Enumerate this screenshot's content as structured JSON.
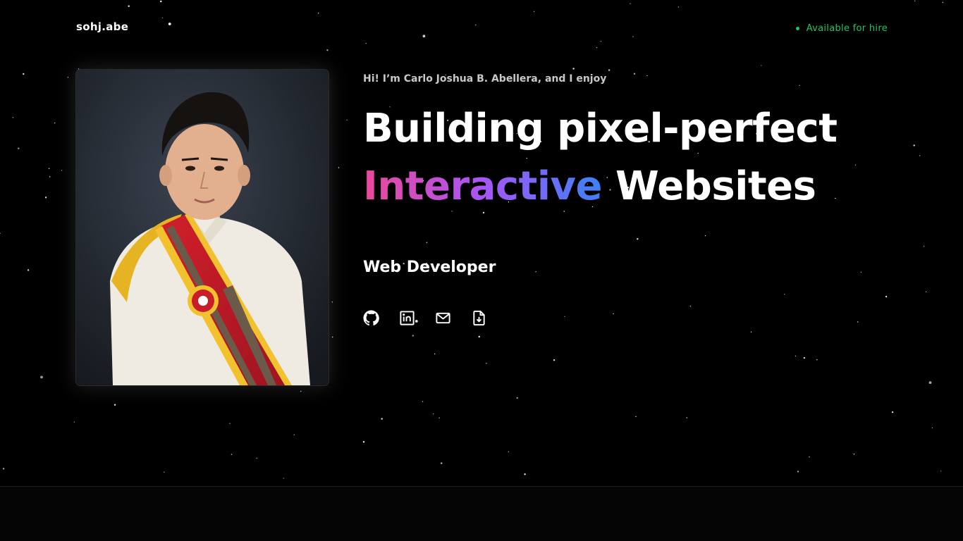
{
  "header": {
    "brand": "sohj.abe",
    "status_label": "Available for hire",
    "status_color": "#22c55e"
  },
  "profile": {
    "photo_alt": "Carlo Joshua B. Abellera"
  },
  "hero": {
    "intro": "Hi! I’m Carlo Joshua B. Abellera, and I enjoy",
    "headline_line1": "Building pixel-perfect",
    "headline_highlight": "Interactive",
    "headline_line2_rest": "Websites",
    "role": "Web Developer",
    "gradient_colors": [
      "#ec4899",
      "#a855f7",
      "#3b82f6"
    ]
  },
  "socials": [
    {
      "name": "github",
      "icon": "github-icon"
    },
    {
      "name": "linkedin",
      "icon": "linkedin-icon"
    },
    {
      "name": "email",
      "icon": "mail-icon"
    },
    {
      "name": "resume",
      "icon": "file-download-icon"
    }
  ],
  "theme": {
    "background": "#000000",
    "text": "#ffffff"
  }
}
